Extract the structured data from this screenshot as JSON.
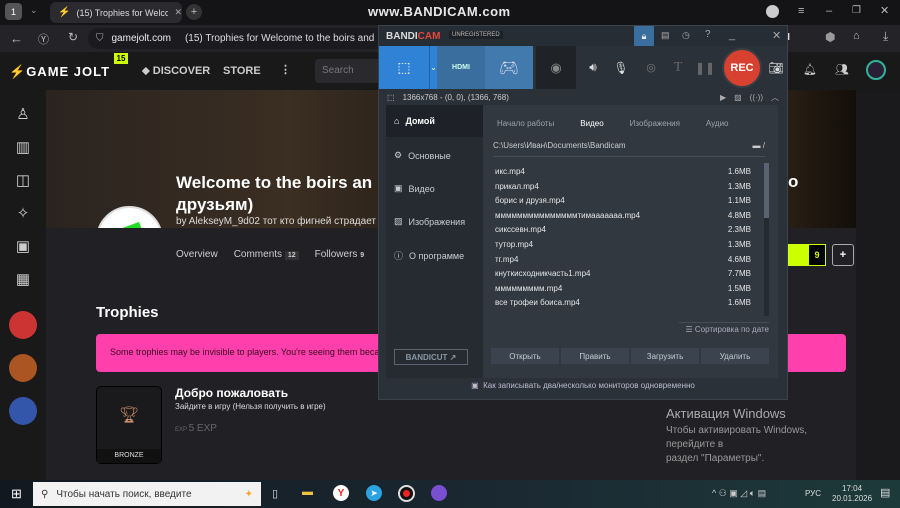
{
  "browser": {
    "tab_count": "1",
    "tab_title": "(15) Trophies for Welcome",
    "watermark": "www.BANDICAM.com",
    "url": "gamejolt.com",
    "page_title": "(15) Trophies for Welcome to the boirs and",
    "ai_label": "AI"
  },
  "gamejolt": {
    "logo": "GAME JOLT",
    "badge": "15",
    "nav": [
      "DISCOVER",
      "STORE"
    ],
    "search_placeholder": "Search",
    "game_title_1": "Welcome to the boirs an",
    "game_title_2": "друзьям)",
    "title_tail": "о",
    "byline": "by AlekseyM_9d02 тот кто фигней страдает",
    "tabs": [
      {
        "label": "Overview"
      },
      {
        "label": "Comments",
        "count": "12"
      },
      {
        "label": "Followers",
        "count": "9"
      }
    ],
    "follow_count": "9",
    "plus": "+",
    "section": "Trophies",
    "notice": "Some trophies may be invisible to players. You're seeing them because",
    "trophy": {
      "name": "Добро пожаловать",
      "desc": "Зайдите в игру (Нельзя получить в игре)",
      "exp": "5 EXP",
      "tier": "BRONZE"
    }
  },
  "bandicam": {
    "brand_a": "BANDI",
    "brand_b": "CAM",
    "unregistered": "UNREGISTERED",
    "hdmi": "HDMI",
    "rec": "REC",
    "area": "1366x768 - (0, 0), (1366, 768)",
    "nav": [
      "Домой",
      "Основные",
      "Видео",
      "Изображения",
      "О программе"
    ],
    "tabs": [
      "Начало работы",
      "Видео",
      "Изображения",
      "Аудио"
    ],
    "path": "C:\\Users\\Иван\\Documents\\Bandicam",
    "files": [
      {
        "name": "икс.mp4",
        "size": "1.6MB"
      },
      {
        "name": "прикал.mp4",
        "size": "1.3MB"
      },
      {
        "name": "борис и друзя.mp4",
        "size": "1.1MB"
      },
      {
        "name": "мммммммммммммммтимааааааа.mp4",
        "size": "4.8MB"
      },
      {
        "name": "сикссевн.mp4",
        "size": "2.3MB"
      },
      {
        "name": "тутор.mp4",
        "size": "1.3MB"
      },
      {
        "name": "тг.mp4",
        "size": "4.6MB"
      },
      {
        "name": "кнуткисходникчасть1.mp4",
        "size": "7.7MB"
      },
      {
        "name": "ммммммммм.mp4",
        "size": "1.5MB"
      },
      {
        "name": "все трофеи боиса.mp4",
        "size": "1.6MB"
      }
    ],
    "sort": "Сортировка по дате",
    "buttons": [
      "Открыть",
      "Править",
      "Загрузить",
      "Удалить"
    ],
    "bandicut": "BANDICUT",
    "tip": "Как записывать два/несколько мониторов одновременно"
  },
  "activation": {
    "title": "Активация Windows",
    "line1": "Чтобы активировать Windows, перейдите в",
    "line2": "раздел \"Параметры\"."
  },
  "taskbar": {
    "search": "Чтобы начать поиск, введите",
    "lang": "РУС",
    "time": "17:04",
    "date": "20.01.2026"
  }
}
